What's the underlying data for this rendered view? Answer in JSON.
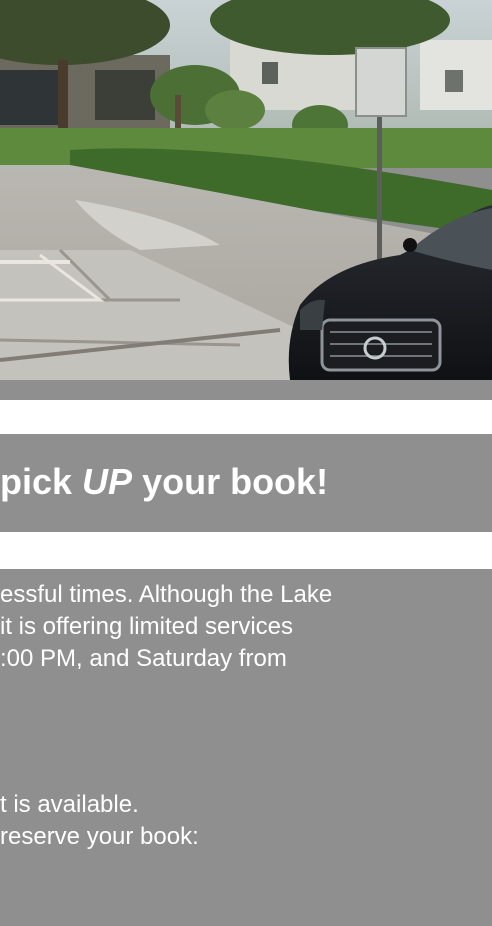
{
  "colors": {
    "panel_gray": "#8f8f8f",
    "text_white": "#ffffff",
    "background": "#ffffff"
  },
  "photo": {
    "icon": "street-photo"
  },
  "banner": {
    "title_prefix": "pick ",
    "title_em": "UP",
    "title_suffix": " your book!"
  },
  "body": {
    "para1": {
      "line1": "essful times. Although the Lake",
      "line2": " it is offering limited services",
      "line3": ":00 PM, and Saturday from"
    },
    "para2": {
      "line1": "t is available.",
      "line2": "reserve your book:"
    }
  }
}
